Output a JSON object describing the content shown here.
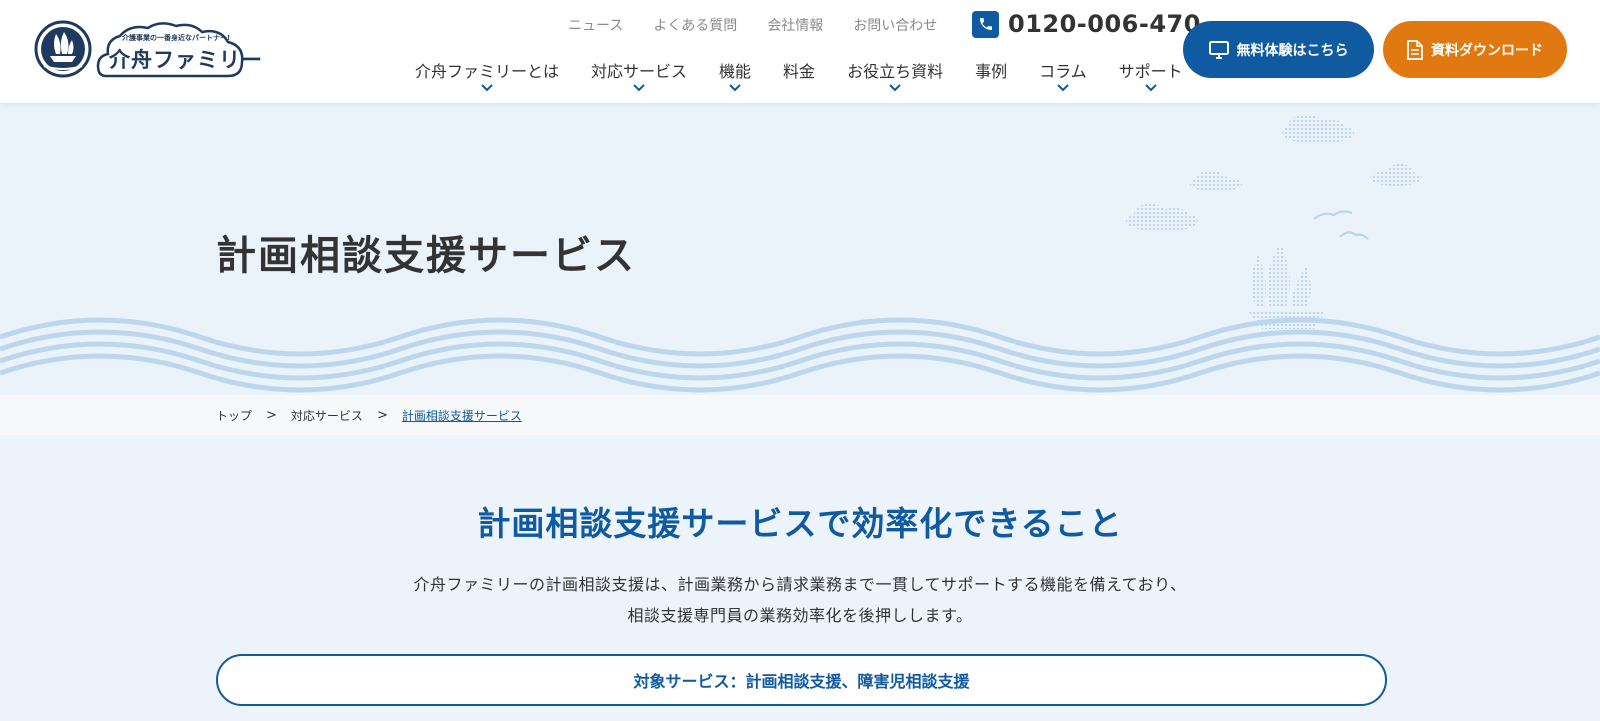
{
  "brand": {
    "tagline": "介護事業の一番身近なパートナー!",
    "name": "介舟ファミリー"
  },
  "util_nav": [
    "ニュース",
    "よくある質問",
    "会社情報",
    "お問い合わせ"
  ],
  "phone": {
    "number": "0120-006-470",
    "icon": "phone-icon"
  },
  "main_nav": [
    {
      "label": "介舟ファミリーとは",
      "has_dropdown": true
    },
    {
      "label": "対応サービス",
      "has_dropdown": true
    },
    {
      "label": "機能",
      "has_dropdown": true
    },
    {
      "label": "料金",
      "has_dropdown": false
    },
    {
      "label": "お役立ち資料",
      "has_dropdown": true
    },
    {
      "label": "事例",
      "has_dropdown": false
    },
    {
      "label": "コラム",
      "has_dropdown": true
    },
    {
      "label": "サポート",
      "has_dropdown": true
    }
  ],
  "buttons": {
    "trial": {
      "label": "無料体験はこちら",
      "icon": "monitor-icon"
    },
    "download": {
      "label": "資料ダウンロード",
      "icon": "document-icon"
    }
  },
  "hero": {
    "title": "計画相談支援サービス"
  },
  "breadcrumb": {
    "items": [
      "トップ",
      "対応サービス",
      "計画相談支援サービス"
    ],
    "separator": ">"
  },
  "section": {
    "title": "計画相談支援サービスで効率化できること",
    "desc_line1": "介舟ファミリーの計画相談支援は、計画業務から請求業務まで一貫してサポートする機能を備えており、",
    "desc_line2": "相談支援専門員の業務効率化を後押しします。",
    "target": "対象サービス：計画相談支援、障害児相談支援"
  },
  "colors": {
    "primary": "#0f5aa0",
    "accent": "#e07a10",
    "hero_bg": "#eaf2fa",
    "wave": "#bcd6ee",
    "text": "#333333"
  }
}
